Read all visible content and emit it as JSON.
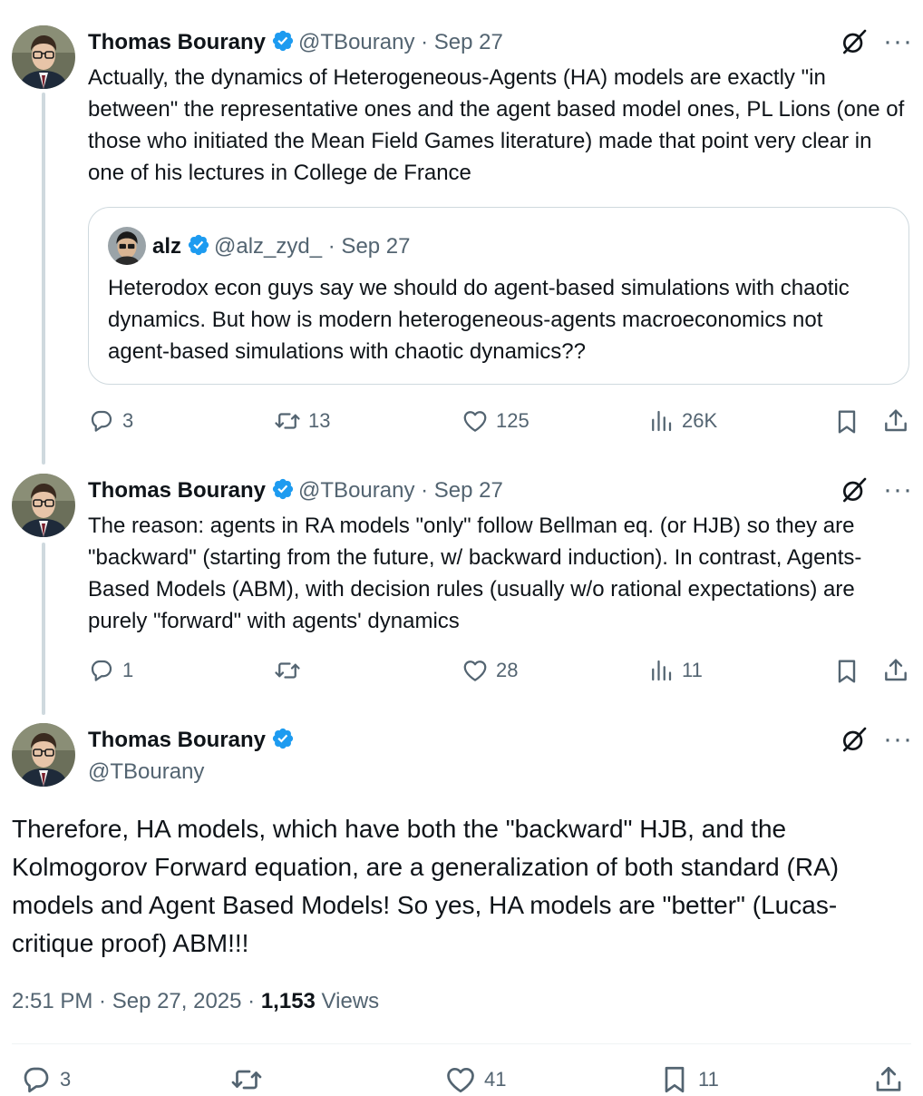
{
  "tweets": [
    {
      "author_name": "Thomas Bourany",
      "handle_time": "@TBourany · Sep 27",
      "text": "Actually, the dynamics of Heterogeneous-Agents (HA) models are exactly \"in between\" the representative ones and the agent based model ones, PL Lions (one of those who initiated the Mean Field Games literature) made that point very clear in one of his lectures in College de France",
      "quote": {
        "author_name": "alz",
        "handle_time": "@alz_zyd_ · Sep 27",
        "text": "Heterodox econ guys say we should do agent-based simulations with chaotic dynamics. But how is modern heterogeneous-agents macroeconomics not agent-based simulations with chaotic dynamics??"
      },
      "actions": {
        "replies": "3",
        "reposts": "13",
        "likes": "125",
        "views": "26K"
      }
    },
    {
      "author_name": "Thomas Bourany",
      "handle_time": "@TBourany · Sep 27",
      "text": "The reason: agents in RA models \"only\" follow Bellman eq. (or HJB) so they are \"backward\" (starting from the future, w/ backward induction). In contrast, Agents-Based Models (ABM), with decision rules (usually w/o rational expectations) are purely \"forward\" with agents' dynamics",
      "actions": {
        "replies": "1",
        "reposts": "",
        "likes": "28",
        "views": "11"
      }
    }
  ],
  "main_tweet": {
    "author_name": "Thomas Bourany",
    "handle": "@TBourany",
    "text": "Therefore, HA models, which have both the \"backward\" HJB, and the Kolmogorov Forward equation, are a generalization of both standard (RA) models and Agent Based Models! So yes, HA models are \"better\" (Lucas-critique proof) ABM!!!",
    "timestamp": "2:51 PM · Sep 27, 2025 · ",
    "views_count": "1,153",
    "views_label": " Views"
  },
  "bottom_actions": {
    "replies": "3",
    "likes": "41",
    "bookmarks": "11"
  },
  "more_glyph": "···",
  "colors": {
    "verified": "#1d9bf0",
    "secondary": "#536471",
    "primary": "#0f1419",
    "border": "#cfd9de"
  },
  "icons": [
    "verified-badge-icon",
    "grok-icon",
    "more-icon",
    "reply-icon",
    "repost-icon",
    "like-icon",
    "views-icon",
    "bookmark-icon",
    "share-icon"
  ]
}
